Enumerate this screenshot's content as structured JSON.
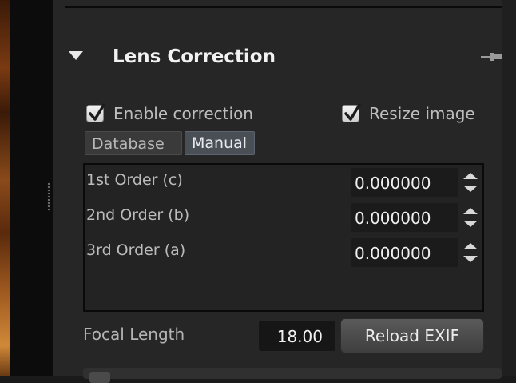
{
  "section": {
    "title": "Lens Correction",
    "icons": {
      "disclosure": "triangle-down-icon",
      "pin": "pin-icon"
    }
  },
  "options": {
    "enable_correction": {
      "label": "Enable correction",
      "checked": true
    },
    "resize_image": {
      "label": "Resize image",
      "checked": true
    }
  },
  "tabs": [
    {
      "label": "Database",
      "selected": false
    },
    {
      "label": "Manual",
      "selected": true
    }
  ],
  "coefficients": [
    {
      "label": "1st Order (c)",
      "value": "0.000000"
    },
    {
      "label": "2nd Order (b)",
      "value": "0.000000"
    },
    {
      "label": "3rd Order (a)",
      "value": "0.000000"
    }
  ],
  "focal": {
    "label": "Focal Length",
    "value": "18.00",
    "reload_label": "Reload EXIF"
  },
  "colors": {
    "panel_bg": "#262626",
    "field_bg": "#1b1b1b",
    "tab_selected": "#4a4f56",
    "title_text": "#f2f2f2"
  }
}
